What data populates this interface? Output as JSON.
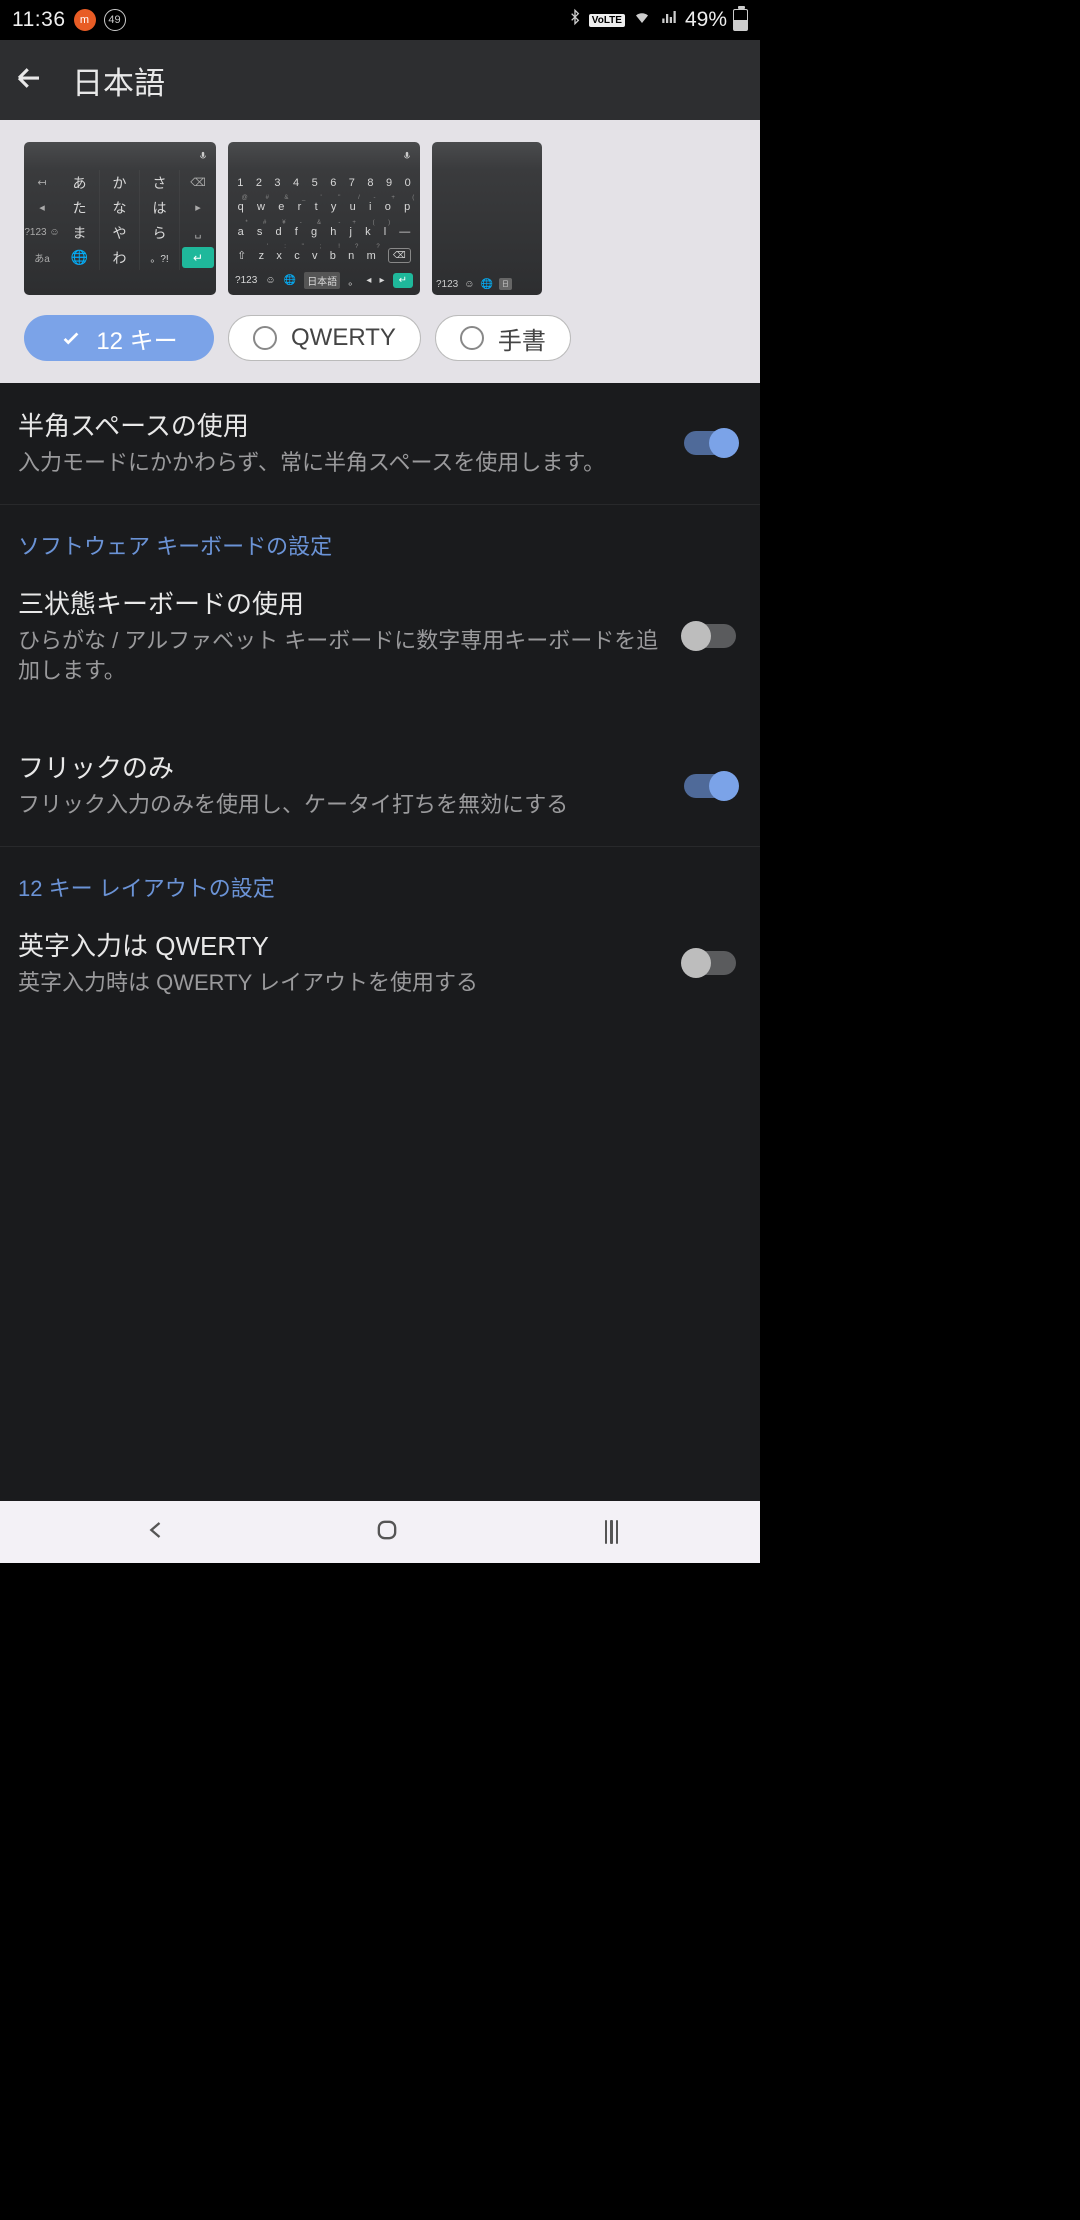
{
  "status": {
    "time": "11:36",
    "notif1": "m",
    "notif2": "49",
    "battery": "49%"
  },
  "header": {
    "title": "日本語"
  },
  "layouts": {
    "options": [
      {
        "label": "12 キー",
        "selected": true
      },
      {
        "label": "QWERTY",
        "selected": false
      },
      {
        "label": "手書",
        "selected": false
      }
    ]
  },
  "settings": {
    "halfwidth_space": {
      "title": "半角スペースの使用",
      "subtitle": "入力モードにかかわらず、常に半角スペースを使用します。",
      "value": true
    },
    "section_softkbd": "ソフトウェア キーボードの設定",
    "tristate": {
      "title": "三状態キーボードの使用",
      "subtitle": "ひらがな / アルファベット キーボードに数字専用キーボードを追加します。",
      "value": false
    },
    "flick_only": {
      "title": "フリックのみ",
      "subtitle": "フリック入力のみを使用し、ケータイ打ちを無効にする",
      "value": true
    },
    "section_12key": "12 キー レイアウトの設定",
    "alpha_qwerty": {
      "title": "英字入力は QWERTY",
      "subtitle": "英字入力時は QWERTY レイアウトを使用する",
      "value": false
    }
  },
  "thumb12": {
    "rows": [
      [
        "↤",
        "あ",
        "か",
        "さ",
        "⌫"
      ],
      [
        "◂",
        "た",
        "な",
        "は",
        "▸"
      ],
      [
        "?123 ☺",
        "ま",
        "や",
        "ら",
        "␣"
      ],
      [
        "あa",
        "⊕",
        "わ",
        "。?!",
        "↵"
      ]
    ],
    "topstrip": [
      "",
      "",
      "",
      "",
      ""
    ]
  },
  "thumbqw": {
    "r1": [
      "1",
      "2",
      "3",
      "4",
      "5",
      "6",
      "7",
      "8",
      "9",
      "0"
    ],
    "r2": [
      "q",
      "w",
      "e",
      "r",
      "t",
      "y",
      "u",
      "i",
      "o",
      "p"
    ],
    "r3": [
      "a",
      "s",
      "d",
      "f",
      "g",
      "h",
      "j",
      "k",
      "l",
      "—"
    ],
    "r4": [
      "⇧",
      "z",
      "x",
      "c",
      "v",
      "b",
      "n",
      "m",
      "⌫"
    ],
    "r5": [
      "?123",
      "☺",
      "⊕",
      "日本語",
      "。",
      "◂",
      "▸",
      "↵"
    ]
  },
  "thumb3": {
    "bottom": [
      "?123",
      "☺",
      "⊕",
      "日"
    ]
  }
}
